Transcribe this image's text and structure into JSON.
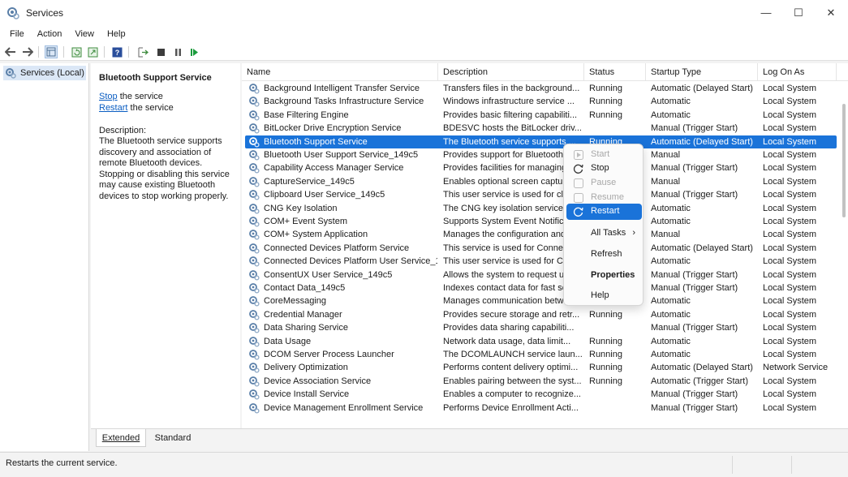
{
  "window": {
    "title": "Services",
    "minimize": "—",
    "maximize": "☐",
    "close": "✕"
  },
  "menubar": [
    "File",
    "Action",
    "View",
    "Help"
  ],
  "toolbar": {
    "icons": [
      "back-icon",
      "forward-icon",
      "show-hide-tree-icon",
      "refresh-icon",
      "export-icon",
      "help-icon",
      "start-service-icon",
      "stop-service-icon",
      "pause-service-icon",
      "resume-service-icon"
    ]
  },
  "tree": {
    "root_label": "Services (Local)"
  },
  "detail": {
    "title": "Bluetooth Support Service",
    "stop_link": "Stop",
    "stop_suffix": " the service",
    "restart_link": "Restart",
    "restart_suffix": " the service",
    "description_label": "Description:",
    "description": "The Bluetooth service supports discovery and association of remote Bluetooth devices. Stopping or disabling this service may cause existing Bluetooth devices to stop working properly."
  },
  "columns": [
    "Name",
    "Description",
    "Status",
    "Startup Type",
    "Log On As"
  ],
  "rows": [
    {
      "name": "Background Intelligent Transfer Service",
      "desc": "Transfers files in the background...",
      "status": "Running",
      "startup": "Automatic (Delayed Start)",
      "logon": "Local System"
    },
    {
      "name": "Background Tasks Infrastructure Service",
      "desc": "Windows infrastructure service ...",
      "status": "Running",
      "startup": "Automatic",
      "logon": "Local System"
    },
    {
      "name": "Base Filtering Engine",
      "desc": "Provides basic filtering capabiliti...",
      "status": "Running",
      "startup": "Automatic",
      "logon": "Local System"
    },
    {
      "name": "BitLocker Drive Encryption Service",
      "desc": "BDESVC hosts the BitLocker driv...",
      "status": "",
      "startup": "Manual (Trigger Start)",
      "logon": "Local System"
    },
    {
      "name": "Bluetooth Support Service",
      "desc": "The Bluetooth service supports ...",
      "status": "Running",
      "startup": "Automatic (Delayed Start)",
      "logon": "Local System",
      "selected": true
    },
    {
      "name": "Bluetooth User Support Service_149c5",
      "desc": "Provides support for Bluetooth ...",
      "status": "",
      "startup": "Manual",
      "logon": "Local System"
    },
    {
      "name": "Capability Access Manager Service",
      "desc": "Provides facilities for managing ...",
      "status": "",
      "startup": "Manual (Trigger Start)",
      "logon": "Local System"
    },
    {
      "name": "CaptureService_149c5",
      "desc": "Enables optional screen capture...",
      "status": "",
      "startup": "Manual",
      "logon": "Local System"
    },
    {
      "name": "Clipboard User Service_149c5",
      "desc": "This user service is used for cl...",
      "status": "",
      "startup": "Manual (Trigger Start)",
      "logon": "Local System"
    },
    {
      "name": "CNG Key Isolation",
      "desc": "The CNG key isolation service i...",
      "status": "",
      "startup": "Automatic",
      "logon": "Local System"
    },
    {
      "name": "COM+ Event System",
      "desc": "Supports System Event Notifica...",
      "status": "",
      "startup": "Automatic",
      "logon": "Local System"
    },
    {
      "name": "COM+ System Application",
      "desc": "Manages the configuration and ...",
      "status": "",
      "startup": "Manual",
      "logon": "Local System"
    },
    {
      "name": "Connected Devices Platform Service",
      "desc": "This service is used for Connecte...",
      "status": "",
      "startup": "Automatic (Delayed Start)",
      "logon": "Local System"
    },
    {
      "name": "Connected Devices Platform User Service_149c5",
      "desc": "This user service is used for Com...",
      "status": "",
      "startup": "Automatic",
      "logon": "Local System"
    },
    {
      "name": "ConsentUX User Service_149c5",
      "desc": "Allows the system to request use...",
      "status": "",
      "startup": "Manual (Trigger Start)",
      "logon": "Local System"
    },
    {
      "name": "Contact Data_149c5",
      "desc": "Indexes contact data for fast sea...",
      "status": "",
      "startup": "Manual (Trigger Start)",
      "logon": "Local System"
    },
    {
      "name": "CoreMessaging",
      "desc": "Manages communication betwe...",
      "status": "",
      "startup": "Automatic",
      "logon": "Local System"
    },
    {
      "name": "Credential Manager",
      "desc": "Provides secure storage and retr...",
      "status": "Running",
      "startup": "Automatic",
      "logon": "Local System"
    },
    {
      "name": "Data Sharing Service",
      "desc": "Provides data sharing capabiliti...",
      "status": "",
      "startup": "Manual (Trigger Start)",
      "logon": "Local System"
    },
    {
      "name": "Data Usage",
      "desc": "Network data usage, data limit...",
      "status": "Running",
      "startup": "Automatic",
      "logon": "Local System"
    },
    {
      "name": "DCOM Server Process Launcher",
      "desc": "The DCOMLAUNCH service laun...",
      "status": "Running",
      "startup": "Automatic",
      "logon": "Local System"
    },
    {
      "name": "Delivery Optimization",
      "desc": "Performs content delivery optimi...",
      "status": "Running",
      "startup": "Automatic (Delayed Start)",
      "logon": "Network Service"
    },
    {
      "name": "Device Association Service",
      "desc": "Enables pairing between the syst...",
      "status": "Running",
      "startup": "Automatic (Trigger Start)",
      "logon": "Local System"
    },
    {
      "name": "Device Install Service",
      "desc": "Enables a computer to recognize...",
      "status": "",
      "startup": "Manual (Trigger Start)",
      "logon": "Local System"
    },
    {
      "name": "Device Management Enrollment Service",
      "desc": "Performs Device Enrollment Acti...",
      "status": "",
      "startup": "Manual (Trigger Start)",
      "logon": "Local System"
    }
  ],
  "context_menu": {
    "start": "Start",
    "stop": "Stop",
    "pause": "Pause",
    "resume": "Resume",
    "restart": "Restart",
    "all_tasks": "All Tasks",
    "refresh": "Refresh",
    "properties": "Properties",
    "help": "Help"
  },
  "tabs": [
    "Extended",
    "Standard"
  ],
  "status_bar": "Restarts the current service.",
  "colors": {
    "selection": "#1a73d9",
    "link": "#0a5dc2",
    "play_green": "#1a9b3c"
  }
}
